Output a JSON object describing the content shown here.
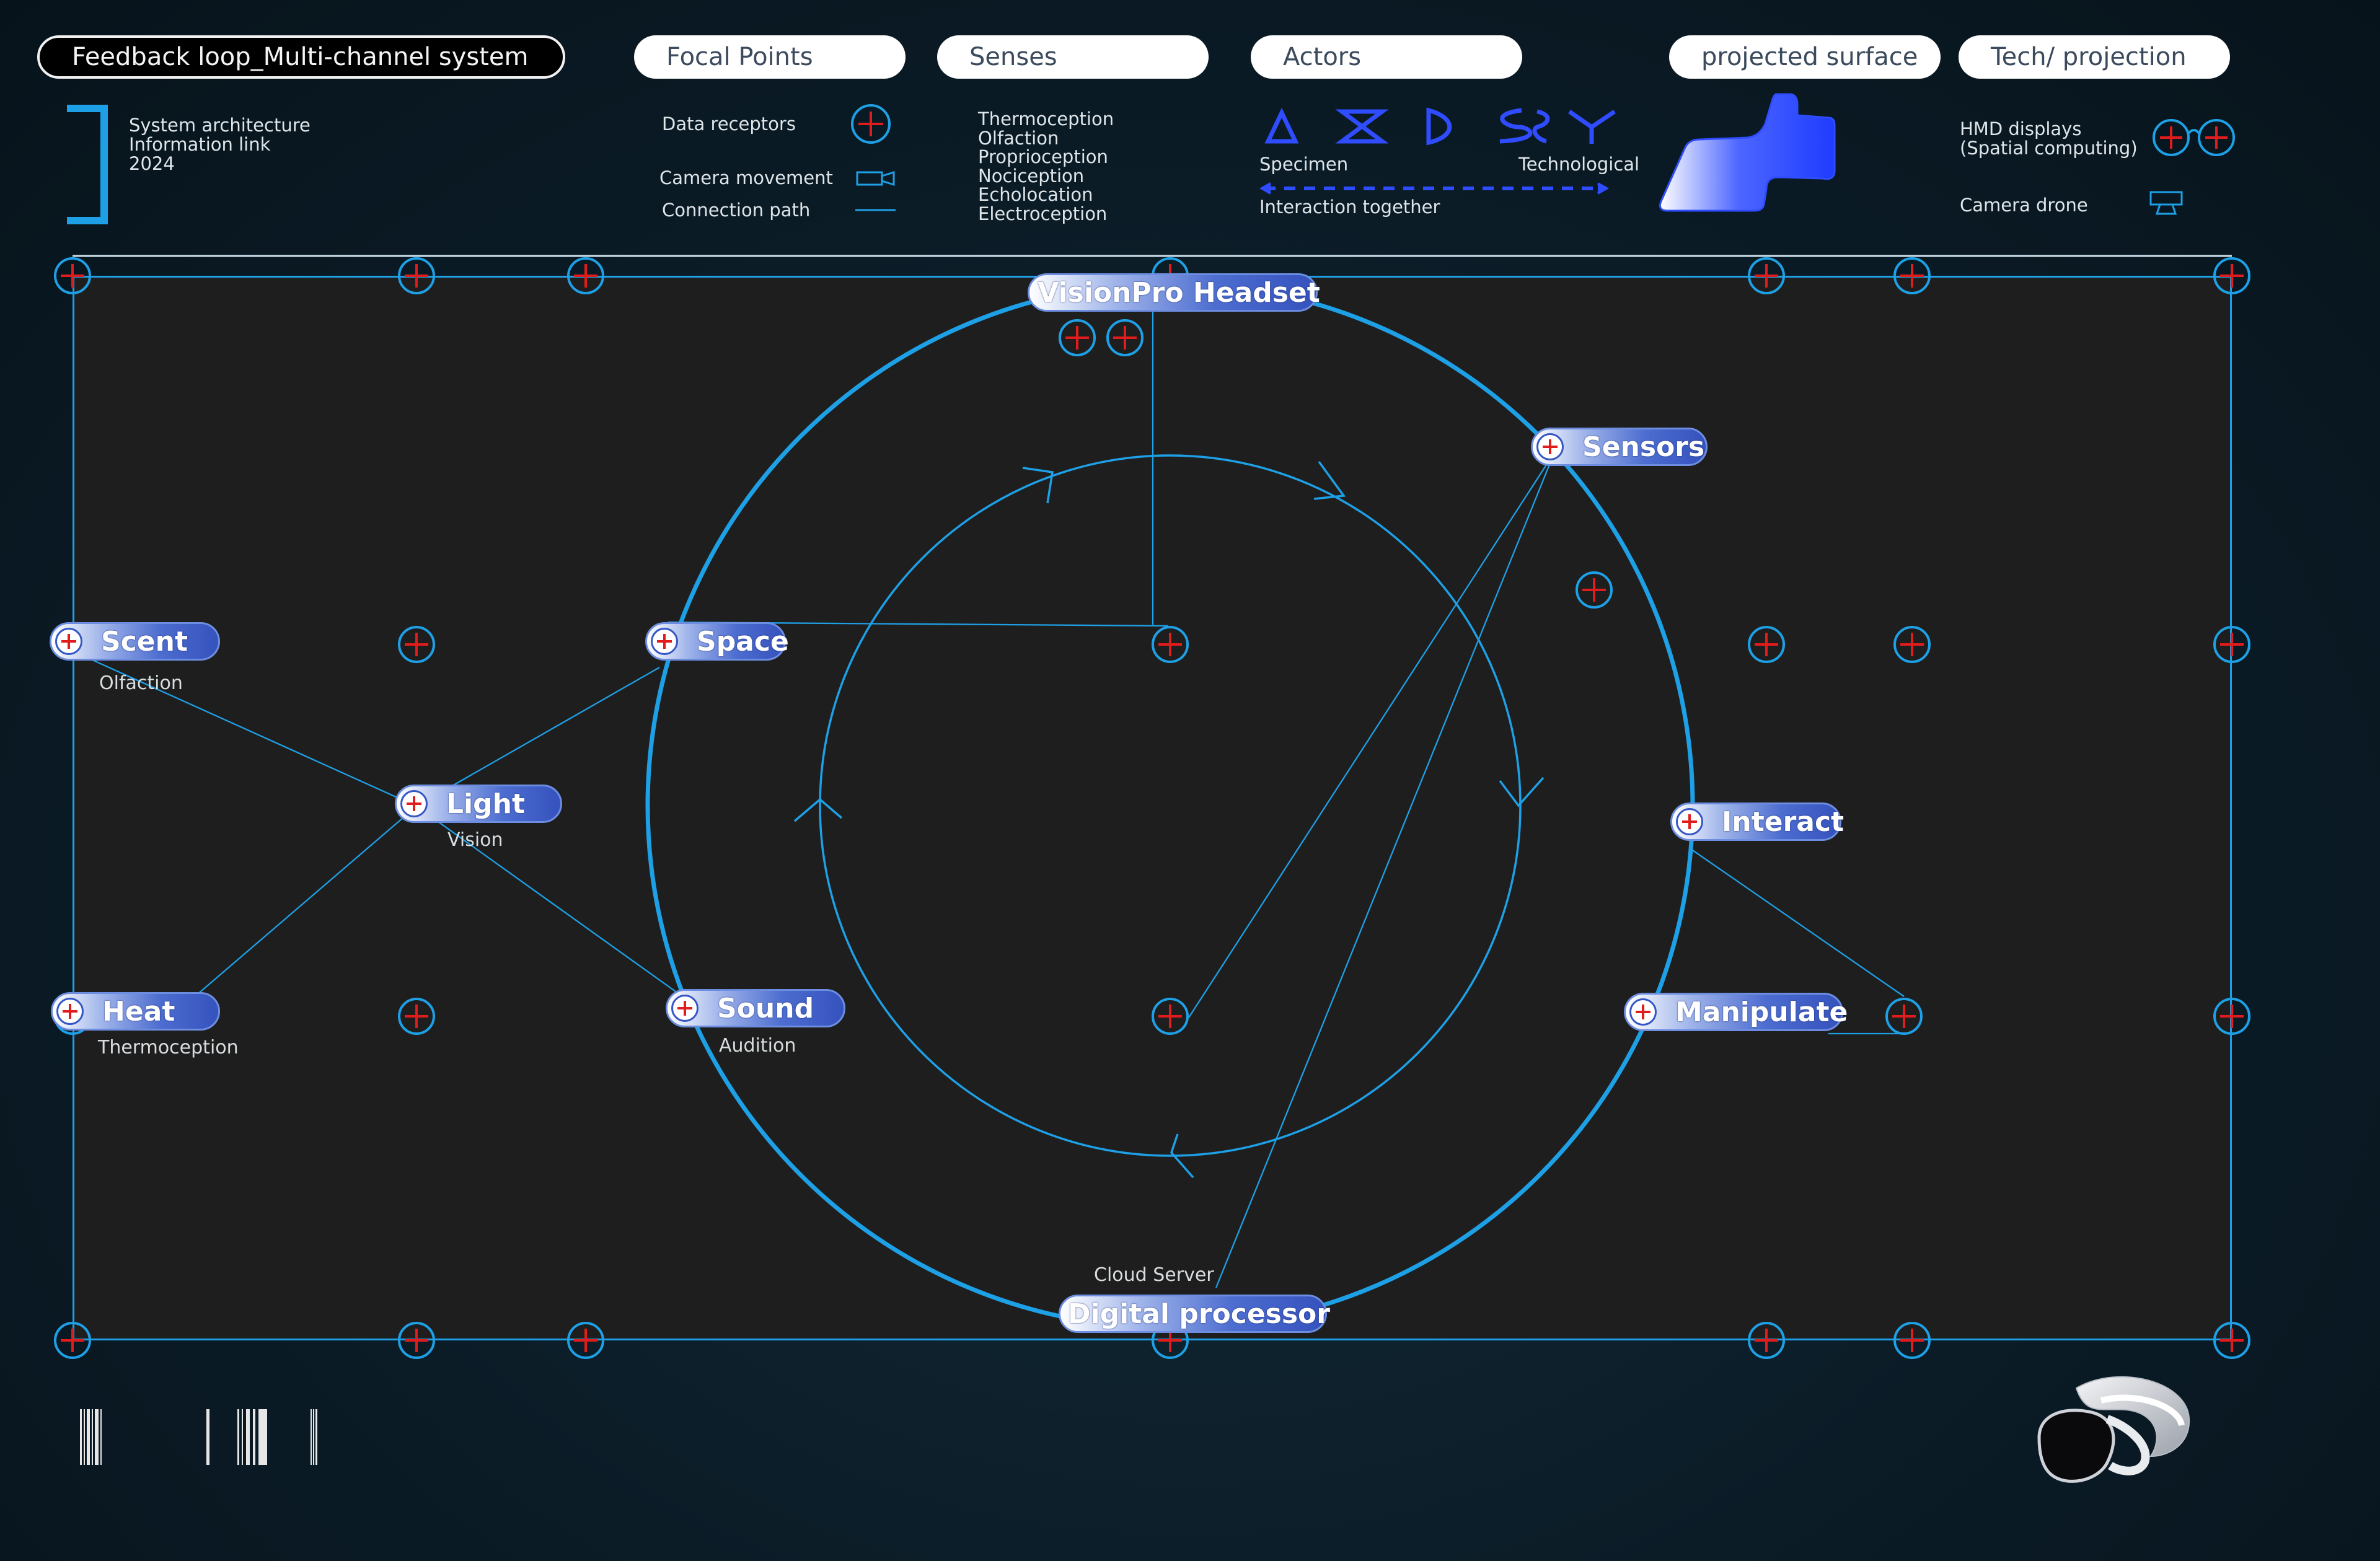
{
  "header": {
    "title": "Feedback loop_Multi-channel system",
    "categories": [
      "Focal Points",
      "Senses",
      "Actors",
      "projected surface",
      "Tech/ projection"
    ]
  },
  "info": {
    "lines": [
      "System architecture",
      "Information link",
      "2024"
    ]
  },
  "legend": {
    "focal_points": {
      "data_receptors": "Data receptors",
      "camera_movement": "Camera movement",
      "connection_path": "Connection path"
    },
    "senses": [
      "Thermoception",
      "Olfaction",
      "Proprioception",
      "Nociception",
      "Echolocation",
      "Electroception"
    ],
    "actors": {
      "specimen": "Specimen",
      "technological": "Technological",
      "interaction": "Interaction together",
      "icons": [
        "triangle-icon",
        "hourglass-icon",
        "half-moon-icon",
        "double-s-icon",
        "y-fork-icon"
      ]
    },
    "tech": {
      "hmd_line1": "HMD displays",
      "hmd_line2": "(Spatial computing)",
      "camera_drone": "Camera drone"
    }
  },
  "diagram": {
    "nodes": {
      "visionpro": "VisionPro Headset",
      "sensors": "Sensors",
      "scent": "Scent",
      "space": "Space",
      "light": "Light",
      "heat": "Heat",
      "sound": "Sound",
      "interact": "Interact",
      "manipulate": "Manipulate",
      "digital": "Digital processor"
    },
    "subs": {
      "olfaction": "Olfaction",
      "vision": "Vision",
      "thermoception": "Thermoception",
      "audition": "Audition",
      "cloud": "Cloud Server"
    }
  },
  "colors": {
    "accent": "#1ea0e6",
    "receptor_plus": "#e11c1c",
    "node_blue": "#3552bd",
    "panel": "#1e1e1e",
    "actor_blue": "#2f4cff"
  }
}
